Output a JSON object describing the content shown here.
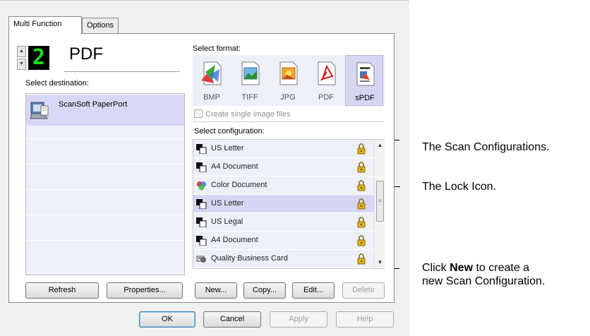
{
  "tabs": [
    {
      "label": "Multi Function",
      "active": true
    },
    {
      "label": "Options",
      "active": false
    }
  ],
  "config_number": {
    "value": "2"
  },
  "selected_format_name": "PDF",
  "destination": {
    "label": "Select destination:",
    "items": [
      {
        "label": "ScanSoft PaperPort",
        "icon": "paperport-icon",
        "selected": true
      }
    ]
  },
  "format": {
    "label": "Select format:",
    "items": [
      {
        "label": "BMP",
        "icon": "bmp-format-icon"
      },
      {
        "label": "TIFF",
        "icon": "tiff-format-icon"
      },
      {
        "label": "JPG",
        "icon": "jpg-format-icon"
      },
      {
        "label": "PDF",
        "icon": "pdf-format-icon"
      },
      {
        "label": "sPDF",
        "icon": "spdf-format-icon",
        "selected": true
      }
    ],
    "single_image_checkbox": {
      "label": "Create single image files",
      "checked": false,
      "enabled": false
    }
  },
  "configuration": {
    "label": "Select configuration:",
    "items": [
      {
        "label": "US Letter",
        "icon": "black-white-doc-icon",
        "locked": true,
        "selected": false
      },
      {
        "label": "A4 Document",
        "icon": "black-white-doc-icon",
        "locked": true,
        "selected": false
      },
      {
        "label": "Color Document",
        "icon": "color-doc-icon",
        "locked": true,
        "selected": false
      },
      {
        "label": "US Letter",
        "icon": "black-white-doc-icon",
        "locked": true,
        "selected": true
      },
      {
        "label": "US Legal",
        "icon": "black-white-doc-icon",
        "locked": true,
        "selected": false
      },
      {
        "label": "A4 Document",
        "icon": "black-white-doc-icon",
        "locked": true,
        "selected": false
      },
      {
        "label": "Quality Business Card",
        "icon": "card-icon",
        "locked": true,
        "selected": false
      }
    ]
  },
  "buttons": {
    "refresh": "Refresh",
    "properties": "Properties...",
    "new": "New...",
    "copy": "Copy...",
    "edit": "Edit...",
    "delete": "Delete",
    "ok": "OK",
    "cancel": "Cancel",
    "apply": "Apply",
    "help": "Help"
  },
  "callouts": {
    "scan_configurations": "The Scan Configurations.",
    "lock_icon": "The Lock Icon.",
    "new_prefix": "Click ",
    "new_bold": "New",
    "new_suffix": " to create a",
    "new_line2": "new Scan Configuration."
  },
  "colors": {
    "selection": "#d6d6f4",
    "list_background": "#eef0f8",
    "digit_green": "#19e019",
    "lock_gold": "#e0b21c"
  }
}
